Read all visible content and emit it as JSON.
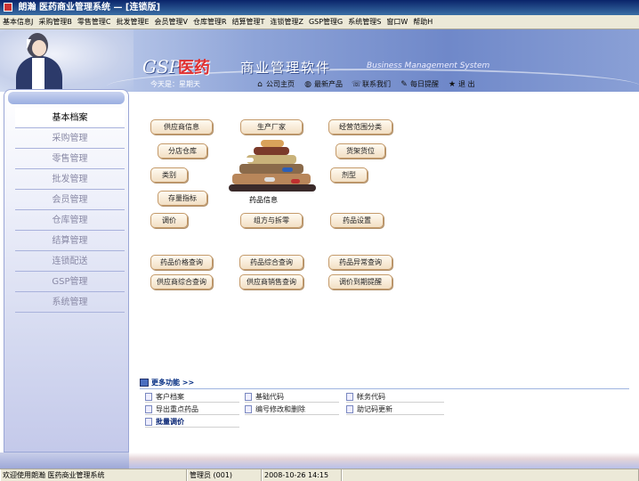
{
  "window": {
    "title": "朗瀚 医药商业管理系统 — [连锁版]"
  },
  "menu": [
    "基本信息J",
    "采购管理B",
    "零售管理C",
    "批发管理E",
    "会员管理V",
    "仓库管理R",
    "结算管理T",
    "连锁管理Z",
    "GSP管理G",
    "系统管理S",
    "窗口W",
    "帮助H"
  ],
  "banner": {
    "brand_gsp": "GSP",
    "brand_cn": "医药",
    "subtitle": "商业管理软件",
    "subtitle_en": "Business Management System"
  },
  "infobar": {
    "today": "今天是：星期天",
    "links": [
      {
        "label": "公司主页",
        "icon": "home-icon",
        "glyph": "⌂"
      },
      {
        "label": "最新产品",
        "icon": "globe-icon",
        "glyph": "◍"
      },
      {
        "label": "联系我们",
        "icon": "phone-icon",
        "glyph": "☏"
      },
      {
        "label": "每日提醒",
        "icon": "notepad-icon",
        "glyph": "✎"
      },
      {
        "label": "退 出",
        "icon": "star-icon",
        "glyph": "★"
      }
    ]
  },
  "sidebar": {
    "items": [
      {
        "label": "基本档案",
        "active": true
      },
      {
        "label": "采购管理"
      },
      {
        "label": "零售管理"
      },
      {
        "label": "批发管理"
      },
      {
        "label": "会员管理"
      },
      {
        "label": "仓库管理"
      },
      {
        "label": "结算管理"
      },
      {
        "label": "连锁配送"
      },
      {
        "label": "GSP管理"
      },
      {
        "label": "系统管理"
      }
    ]
  },
  "main": {
    "buttons": {
      "supplier_info": "供应商信息",
      "manufacturer": "生产厂家",
      "business_scope": "经营范围分类",
      "branch_warehouse": "分店仓库",
      "shelf_position": "货架货位",
      "category": "类别",
      "dosage_form": "剂型",
      "stock_indicator": "存量指标",
      "price_adjust": "调价",
      "compose_split": "组方与拆零",
      "drug_settings": "药品设置",
      "drug_price_query": "药品价格查询",
      "drug_combined_query": "药品综合查询",
      "drug_abnormal_query": "药品异常查询",
      "supplier_combined_query": "供应商综合查询",
      "supplier_sales_query": "供应商销售查询",
      "price_due_reminder": "调价到期提醒"
    },
    "drug_info_label": "药品信息",
    "more": {
      "title": "更多功能 >>",
      "links": {
        "customer_archive": "客户档案",
        "basic_code": "基础代码",
        "account_code": "帐务代码",
        "export_key_drugs": "导出重点药品",
        "code_modify_delete": "编号修改和删除",
        "mnemonic_update": "助记码更新",
        "batch_price": "批量调价"
      }
    }
  },
  "statusbar": {
    "welcome": "欢迎使用朗瀚 医药商业管理系统",
    "user": "管理员 (001)",
    "datetime": "2008-10-26 14:15"
  },
  "colors": {
    "banner": "#6f88c9",
    "button_bg": "#f2dfc4",
    "nav_active": "#ffffff",
    "titlebar": "#0a246a"
  }
}
